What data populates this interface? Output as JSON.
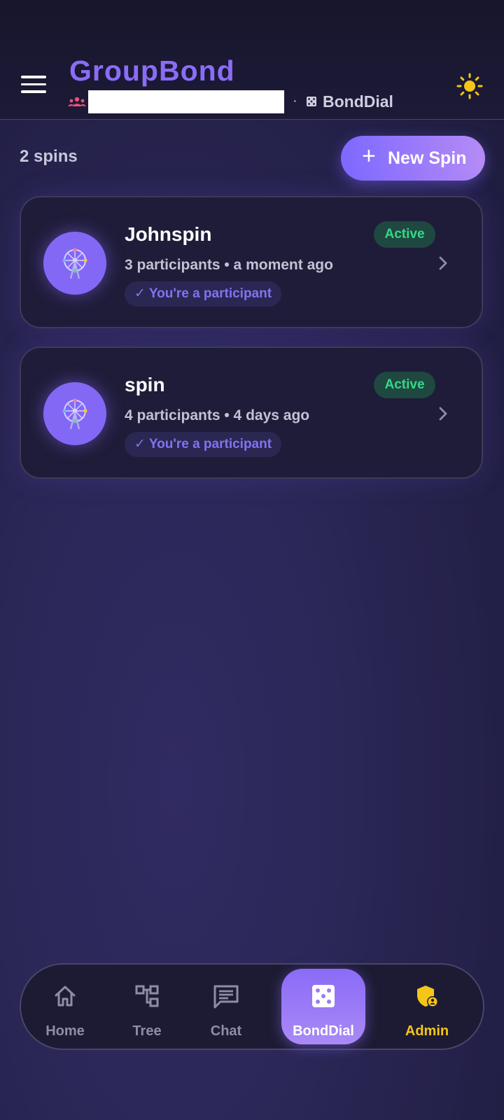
{
  "header": {
    "app_title": "GroupBond",
    "separator": "·",
    "section_name": "BondDial"
  },
  "toolbar": {
    "spin_count": "2 spins",
    "new_spin_icon": "+",
    "new_spin_label": "New Spin"
  },
  "spins": [
    {
      "title": "Johnspin",
      "meta": "3 participants • a moment ago",
      "badge": "✓ You're a participant",
      "status": "Active",
      "icon": "ferris-wheel-icon"
    },
    {
      "title": "spin",
      "meta": "4 participants • 4 days ago",
      "badge": "✓ You're a participant",
      "status": "Active",
      "icon": "ferris-wheel-icon"
    }
  ],
  "nav": {
    "items": [
      {
        "label": "Home",
        "icon": "home-icon"
      },
      {
        "label": "Tree",
        "icon": "tree-icon"
      },
      {
        "label": "Chat",
        "icon": "chat-icon"
      },
      {
        "label": "BondDial",
        "icon": "dice-icon"
      },
      {
        "label": "Admin",
        "icon": "admin-shield-icon"
      }
    ],
    "active": "BondDial"
  },
  "colors": {
    "accent": "#8b6cf5",
    "status_active": "#33d986",
    "admin": "#f5c518",
    "theme_sun": "#f5c518"
  }
}
